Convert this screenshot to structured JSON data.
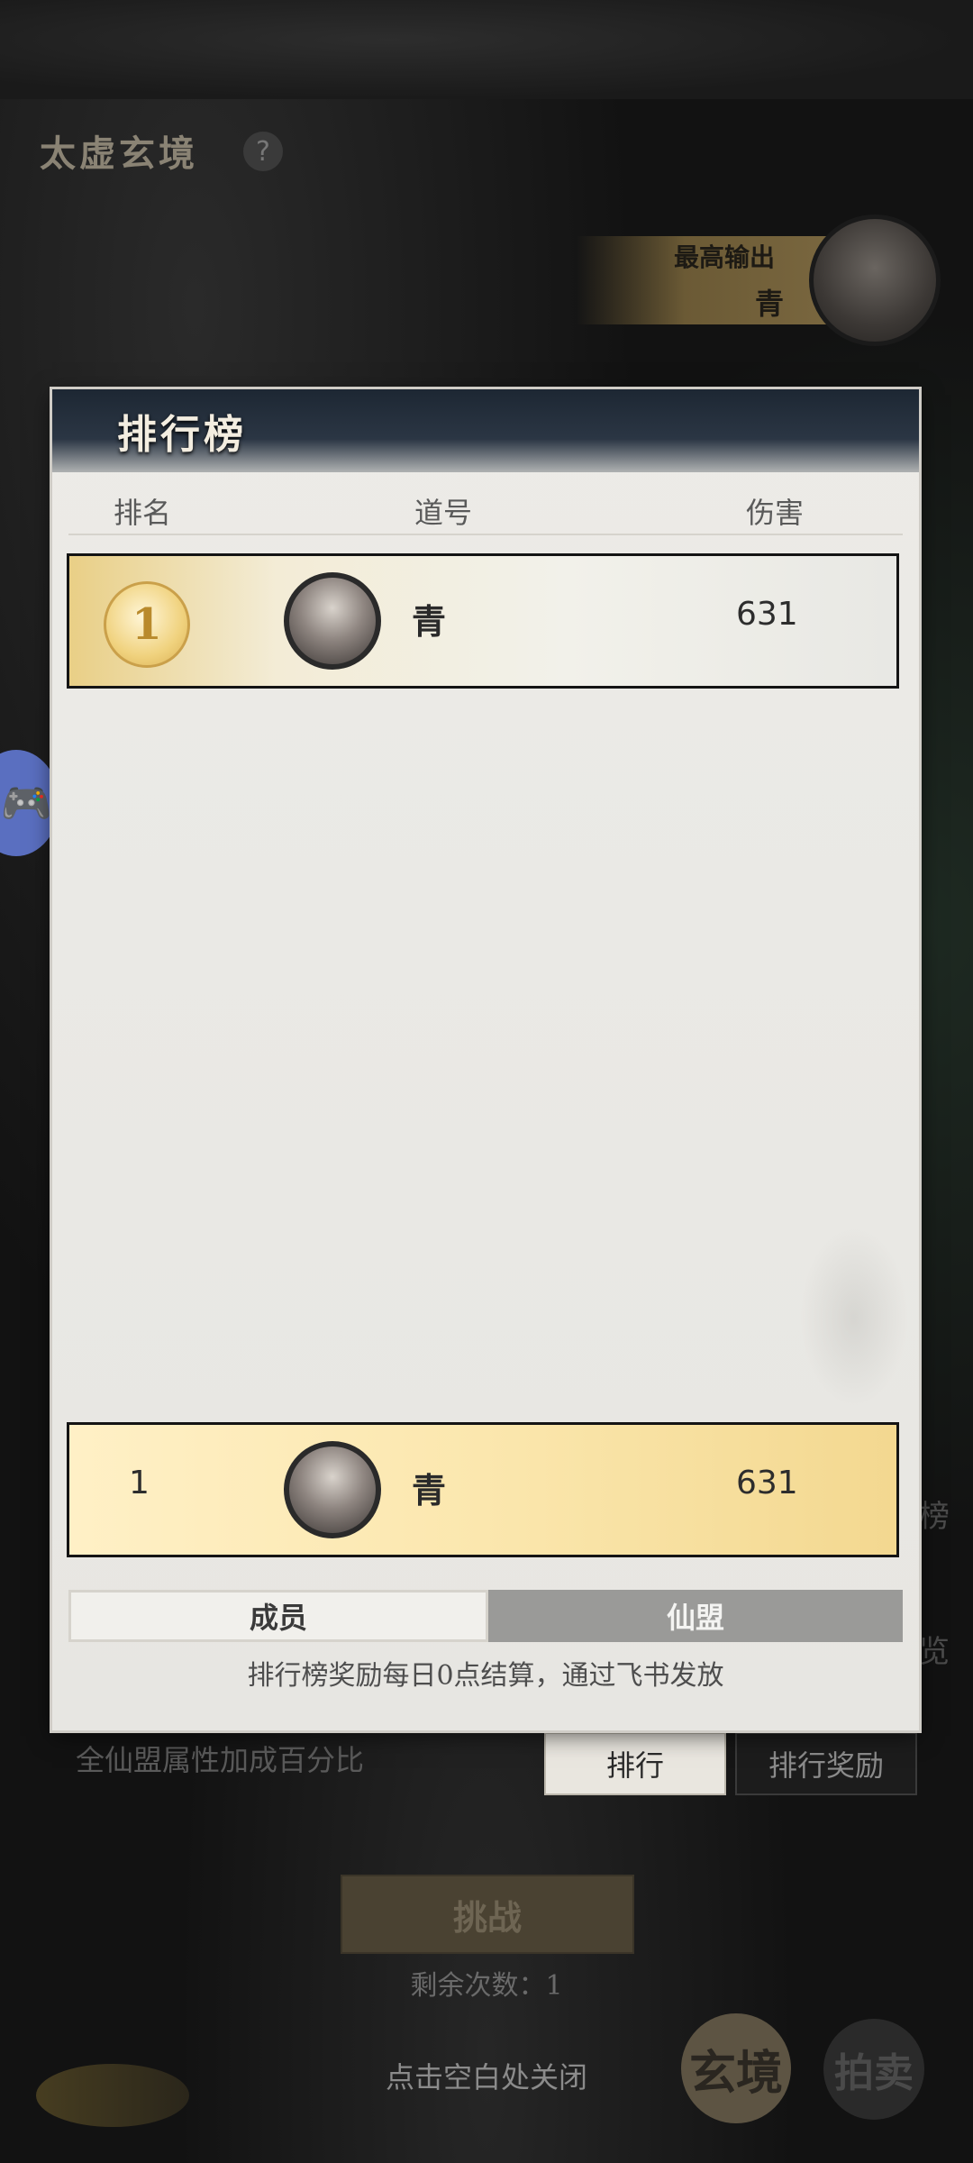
{
  "scene": {
    "title": "太虚玄境",
    "help_icon": "?",
    "top_output_label": "最高输出",
    "top_output_name": "青",
    "side_text_1": "榜",
    "side_text_2": "览",
    "float_icon": "🎮"
  },
  "modal": {
    "title": "排行榜",
    "columns": {
      "rank": "排名",
      "name": "道号",
      "damage": "伤害"
    },
    "rows": [
      {
        "rank": "1",
        "name": "青",
        "damage": "631"
      }
    ],
    "self_row": {
      "rank": "1",
      "name": "青",
      "damage": "631"
    },
    "segments": {
      "members": "成员",
      "alliance": "仙盟"
    },
    "footer_note": "排行榜奖励每日0点结算，通过飞书发放"
  },
  "bottom": {
    "bonus_text": "全仙盟属性加成百分比",
    "tab_rank": "排行",
    "tab_reward": "排行奖励",
    "challenge": "挑战",
    "remaining": "剩余次数：1",
    "close_hint": "点击空白处关闭",
    "round_btn_1": "玄境",
    "round_btn_2": "拍卖"
  },
  "colors": {
    "gold": "#e9cf86",
    "self_row": "#fbe7ae",
    "header": "#1d2733"
  }
}
